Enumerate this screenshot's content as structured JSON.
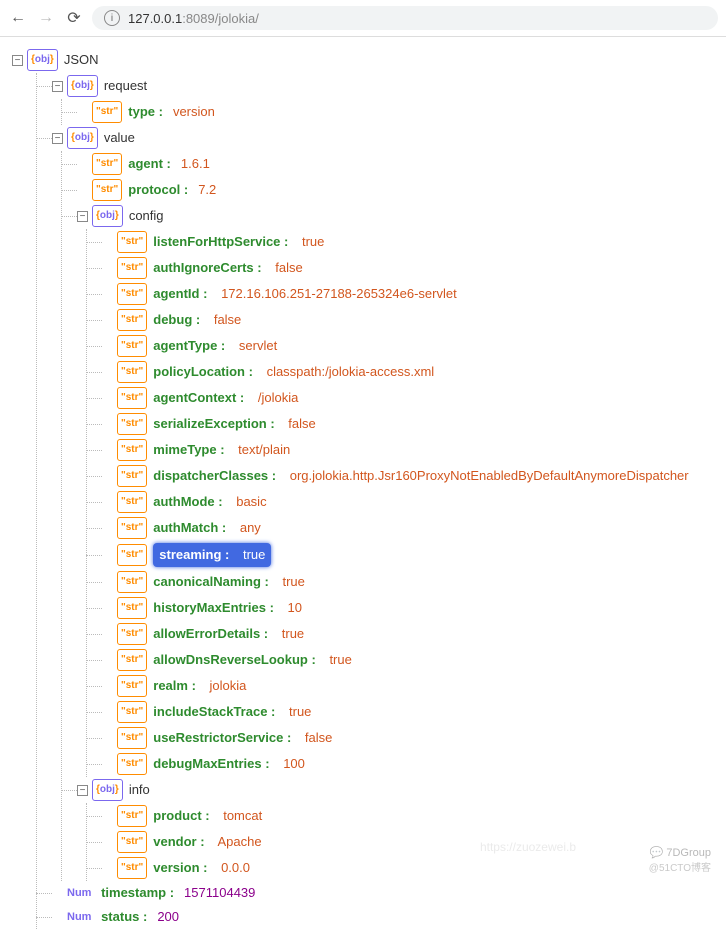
{
  "url": {
    "host": "127.0.0.1",
    "port": ":8089",
    "path": "/jolokia/"
  },
  "root": "JSON",
  "request": {
    "label": "request",
    "type_key": "type :",
    "type_val": "version"
  },
  "value": {
    "label": "value",
    "agent": {
      "k": "agent :",
      "v": "1.6.1"
    },
    "protocol": {
      "k": "protocol :",
      "v": "7.2"
    },
    "config": {
      "label": "config",
      "items": [
        {
          "k": "listenForHttpService :",
          "v": "true"
        },
        {
          "k": "authIgnoreCerts :",
          "v": "false"
        },
        {
          "k": "agentId :",
          "v": "172.16.106.251-27188-265324e6-servlet"
        },
        {
          "k": "debug :",
          "v": "false"
        },
        {
          "k": "agentType :",
          "v": "servlet"
        },
        {
          "k": "policyLocation :",
          "v": "classpath:/jolokia-access.xml"
        },
        {
          "k": "agentContext :",
          "v": "/jolokia"
        },
        {
          "k": "serializeException :",
          "v": "false"
        },
        {
          "k": "mimeType :",
          "v": "text/plain"
        },
        {
          "k": "dispatcherClasses :",
          "v": "org.jolokia.http.Jsr160ProxyNotEnabledByDefaultAnymoreDispatcher"
        },
        {
          "k": "authMode :",
          "v": "basic"
        },
        {
          "k": "authMatch :",
          "v": "any"
        },
        {
          "k": "streaming :",
          "v": "true",
          "highlight": true
        },
        {
          "k": "canonicalNaming :",
          "v": "true"
        },
        {
          "k": "historyMaxEntries :",
          "v": "10"
        },
        {
          "k": "allowErrorDetails :",
          "v": "true"
        },
        {
          "k": "allowDnsReverseLookup :",
          "v": "true"
        },
        {
          "k": "realm :",
          "v": "jolokia"
        },
        {
          "k": "includeStackTrace :",
          "v": "true"
        },
        {
          "k": "useRestrictorService :",
          "v": "false"
        },
        {
          "k": "debugMaxEntries :",
          "v": "100"
        }
      ]
    },
    "info": {
      "label": "info",
      "items": [
        {
          "k": "product :",
          "v": "tomcat"
        },
        {
          "k": "vendor :",
          "v": "Apache"
        },
        {
          "k": "version :",
          "v": "0.0.0"
        }
      ]
    }
  },
  "timestamp": {
    "k": "timestamp :",
    "v": "1571104439"
  },
  "status": {
    "k": "status :",
    "v": "200"
  },
  "watermark": {
    "line1": "7DGroup",
    "line2": "@51CTO博客"
  },
  "faded": "https://zuozewei.b"
}
